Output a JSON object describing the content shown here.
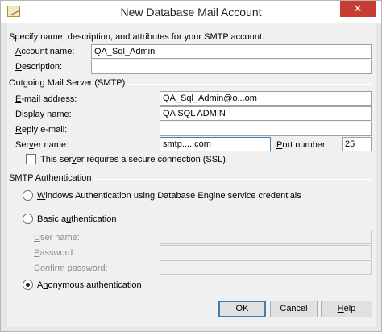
{
  "window": {
    "title": "New Database Mail Account",
    "close_glyph": "✕"
  },
  "intro": "Specify name, description, and attributes for your SMTP account.",
  "account": {
    "name_label_pre": "",
    "name_label_u": "A",
    "name_label_post": "ccount name:",
    "name_value": "QA_Sql_Admin",
    "desc_label_pre": "",
    "desc_label_u": "D",
    "desc_label_post": "escription:",
    "desc_value": ""
  },
  "outgoing": {
    "group_label": "Outgoing Mail Server (SMTP)",
    "email_label_pre": "",
    "email_label_u": "E",
    "email_label_post": "-mail address:",
    "email_value": "QA_Sql_Admin@o...om",
    "display_label_pre": "D",
    "display_label_u": "i",
    "display_label_post": "splay name:",
    "display_value": "QA SQL ADMIN",
    "reply_label_pre": "",
    "reply_label_u": "R",
    "reply_label_post": "eply e-mail:",
    "reply_value": "",
    "server_label_pre": "Ser",
    "server_label_u": "v",
    "server_label_post": "er name:",
    "server_value": "smtp.....com",
    "port_label_pre": "",
    "port_label_u": "P",
    "port_label_post": "ort number:",
    "port_value": "25",
    "ssl_label_pre": "This ser",
    "ssl_label_u": "v",
    "ssl_label_post": "er requires a secure connection (SSL)",
    "ssl_checked": false
  },
  "auth": {
    "group_label": "SMTP Authentication",
    "windows_label_pre": "",
    "windows_label_u": "W",
    "windows_label_post": "indows Authentication using Database Engine service credentials",
    "basic_label_pre": "Basic a",
    "basic_label_u": "u",
    "basic_label_post": "thentication",
    "username_label_pre": "",
    "username_label_u": "U",
    "username_label_post": "ser name:",
    "password_label_pre": "",
    "password_label_u": "P",
    "password_label_post": "assword:",
    "confirm_label_pre": "Confir",
    "confirm_label_u": "m",
    "confirm_label_post": " password:",
    "anonymous_label_pre": "A",
    "anonymous_label_u": "n",
    "anonymous_label_post": "onymous authentication",
    "selected": "anonymous"
  },
  "buttons": {
    "ok": "OK",
    "cancel": "Cancel",
    "help_pre": "",
    "help_u": "H",
    "help_post": "elp"
  }
}
